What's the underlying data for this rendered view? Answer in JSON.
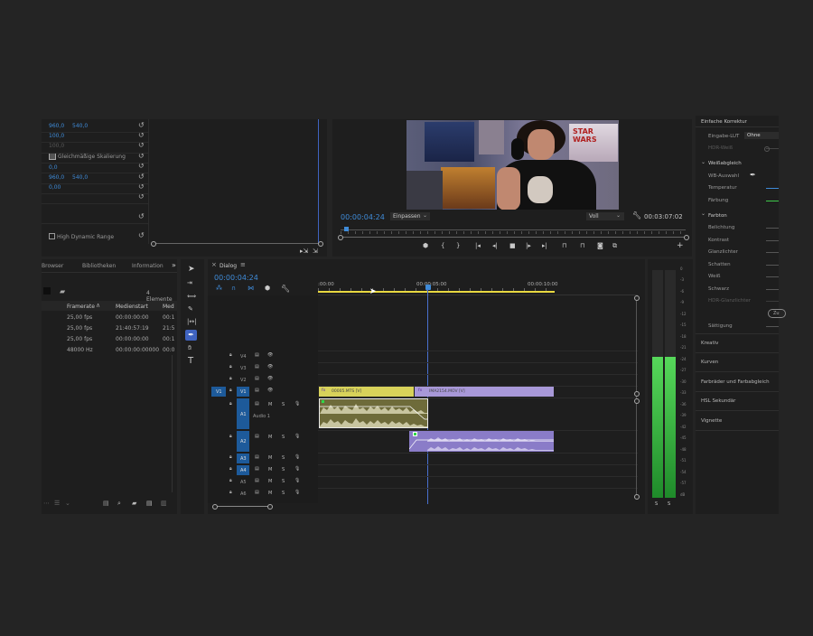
{
  "effect_controls": {
    "rows": [
      {
        "v1": "960,0",
        "v2": "540,0",
        "dim": false
      },
      {
        "v1": "100,0",
        "v2": "",
        "dim": false
      },
      {
        "v1": "100,0",
        "v2": "",
        "dim": true
      },
      {
        "v1": "",
        "v2": "",
        "dim": false
      },
      {
        "v1": "0,0",
        "v2": "",
        "dim": false
      },
      {
        "v1": "960,0",
        "v2": "540,0",
        "dim": false
      },
      {
        "v1": "0,00",
        "v2": "",
        "dim": false
      }
    ],
    "uniform_scale_label": "Gleichmäßige Skalierung",
    "hdr_label": "High Dynamic Range"
  },
  "program_monitor": {
    "timecode": "00:00:04:24",
    "fit_label": "Einpassen",
    "quality_label": "Voll",
    "duration": "00:03:07:02",
    "poster_text": "STAR WARS"
  },
  "project_panel": {
    "tabs": [
      "Browser",
      "Bibliotheken",
      "Information"
    ],
    "more": "»",
    "items_count": "4 Elemente",
    "columns": [
      "Framerate",
      "Medienstart",
      "Med"
    ],
    "rows": [
      {
        "framerate": "25,00 fps",
        "start": "00:00:00:00",
        "med": "00:1"
      },
      {
        "framerate": "25,00 fps",
        "start": "21:40:57:19",
        "med": "21:5"
      },
      {
        "framerate": "25,00 fps",
        "start": "00:00:00:00",
        "med": "00:1"
      },
      {
        "framerate": "48000  Hz",
        "start": "00:00:00:00000",
        "med": "00:0"
      }
    ]
  },
  "timeline": {
    "tab": "Dialog",
    "timecode": "00:00:04:24",
    "ruler": [
      ":00:00",
      "00:00:05:00",
      "00:00:10:00"
    ],
    "video_tracks": [
      "V4",
      "V3",
      "V2",
      "V1"
    ],
    "source_patch": "V1",
    "audio_tracks": [
      "A1",
      "A2",
      "A3",
      "A4",
      "A5",
      "A6"
    ],
    "audio1_name": "Audio 1",
    "mute": "M",
    "solo": "S",
    "clip1_name": "00005.MTS [V]",
    "clip2_name": "IMA2154.MOV [V]",
    "fx_label": "fx"
  },
  "audio_meter": {
    "scale": [
      "0",
      "-3",
      "-6",
      "-9",
      "-12",
      "-15",
      "-18",
      "-21",
      "-24",
      "-27",
      "-30",
      "-33",
      "-36",
      "-39",
      "-42",
      "-45",
      "-48",
      "-51",
      "-54",
      "-57",
      "dB"
    ],
    "solo_labels": [
      "S",
      "S"
    ],
    "level": 0.62
  },
  "lumetri": {
    "header": "Einfache Korrektur",
    "input_lut_label": "Eingabe-LUT",
    "input_lut_value": "Ohne",
    "hdr_white": "HDR-Weiß",
    "white_balance": "Weißabgleich",
    "wb_picker": "WB-Auswahl",
    "temperature": "Temperatur",
    "tint": "Färbung",
    "tone": "Farbton",
    "tone_items": [
      "Belichtung",
      "Kontrast",
      "Glanzlichter",
      "Schatten",
      "Weiß",
      "Schwarz",
      "HDR-Glanzlichter"
    ],
    "auto_button": "Zu",
    "saturation": "Sättigung",
    "sections": [
      "Kreativ",
      "Kurven",
      "Farbräder und Farbabgleich",
      "HSL Sekundär",
      "Vignette"
    ],
    "temp_color": "#3f8bd8",
    "tint_color": "#3fc84a"
  }
}
